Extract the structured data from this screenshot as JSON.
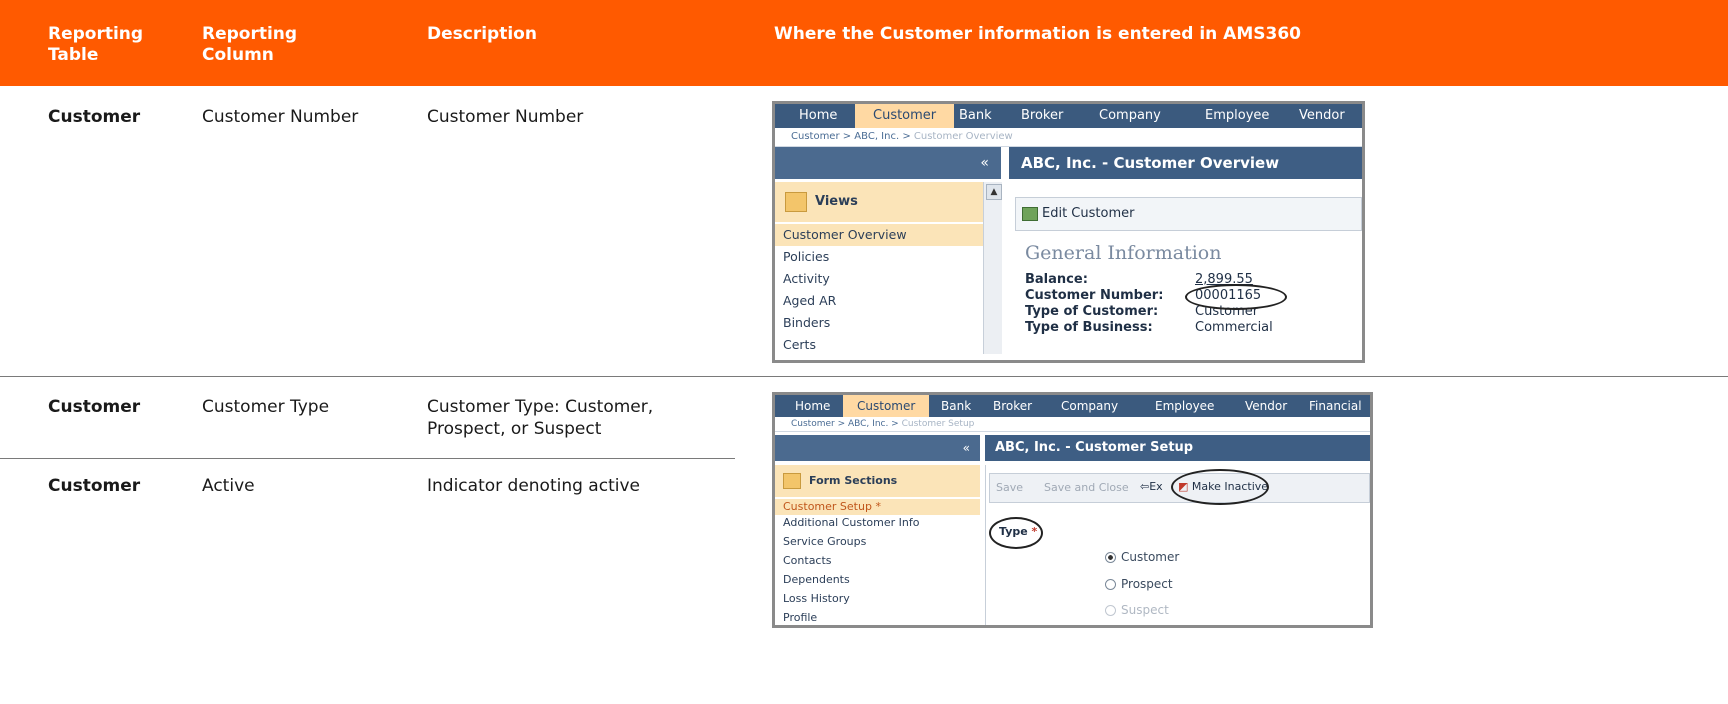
{
  "header": {
    "col1": "Reporting\nTable",
    "col2": "Reporting\nColumn",
    "col3": "Description",
    "col4": "Where the Customer information is entered in AMS360"
  },
  "rows": [
    {
      "table": "Customer",
      "column": "Customer Number",
      "description": "Customer Number"
    },
    {
      "table": "Customer",
      "column": "Customer Type",
      "description": "Customer Type:  Customer,\nProspect, or Suspect"
    },
    {
      "table": "Customer",
      "column": "Active",
      "description": "Indicator denoting active"
    }
  ],
  "shot1": {
    "nav": [
      "Home",
      "Customer",
      "Bank",
      "Broker",
      "Company",
      "Employee",
      "Vendor"
    ],
    "crumb_links": "Customer  >  ABC, Inc.  >",
    "crumb_current": "Customer Overview",
    "collapse": "«",
    "title": "ABC, Inc. - Customer Overview",
    "views_label": "Views",
    "menu": [
      "Customer Overview",
      "Policies",
      "Activity",
      "Aged AR",
      "Binders",
      "Certs"
    ],
    "edit_button": "Edit Customer",
    "section_title": "General Information",
    "fields": [
      {
        "label": "Balance:",
        "value": "2,899.55"
      },
      {
        "label": "Customer Number:",
        "value": "00001165"
      },
      {
        "label": "Type of Customer:",
        "value": "Customer"
      },
      {
        "label": "Type of Business:",
        "value": "Commercial"
      }
    ]
  },
  "shot2": {
    "nav": [
      "Home",
      "Customer",
      "Bank",
      "Broker",
      "Company",
      "Employee",
      "Vendor",
      "Financial"
    ],
    "crumb_links": "Customer  >  ABC, Inc.  >",
    "crumb_current": "Customer Setup",
    "collapse": "«",
    "title": "ABC, Inc. - Customer Setup",
    "sections_label": "Form Sections",
    "menu": [
      "Customer Setup *",
      "Additional Customer Info",
      "Service Groups",
      "Contacts",
      "Dependents",
      "Loss History",
      "Profile"
    ],
    "toolbar": [
      "Save",
      "Save and Close",
      "Exit",
      "Make Inactive"
    ],
    "type_label": "Type",
    "required_mark": "*",
    "radios": [
      "Customer",
      "Prospect",
      "Suspect"
    ]
  }
}
